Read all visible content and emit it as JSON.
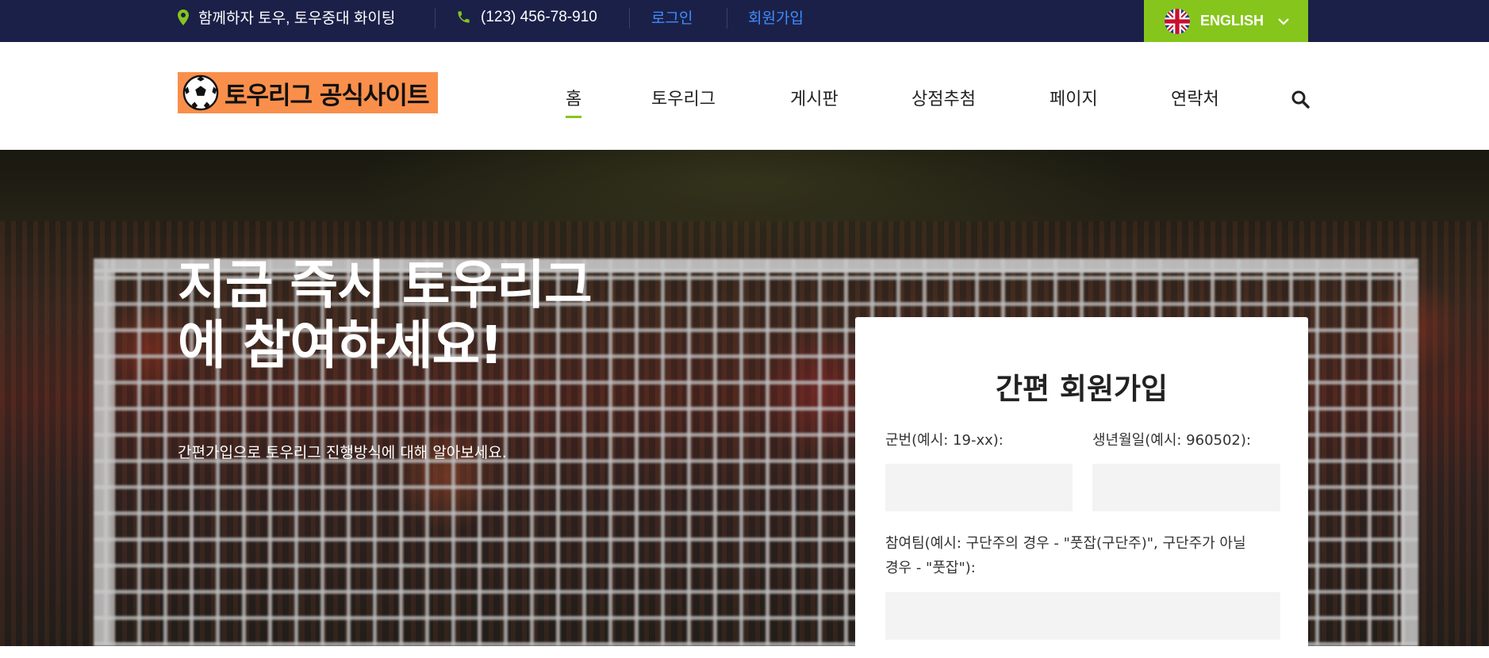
{
  "topbar": {
    "address": "함께하자 토우, 토우중대 화이팅",
    "phone": "(123) 456-78-910",
    "login": "로그인",
    "register": "회원가입",
    "language": "ENGLISH",
    "icons": {
      "pin": "map-pin-icon",
      "phone": "phone-icon",
      "flag": "uk-flag-icon",
      "chevron": "chevron-down-icon"
    },
    "colors": {
      "background": "#1b2048",
      "link": "#3f8dff",
      "accent": "#86c51c"
    }
  },
  "header": {
    "logo_text": "토우리그 공식사이트",
    "logo_bg": "#f98f4b",
    "nav": [
      {
        "label": "홈",
        "active": true
      },
      {
        "label": "토우리그",
        "active": false
      },
      {
        "label": "게시판",
        "active": false
      },
      {
        "label": "상점추첨",
        "active": false
      },
      {
        "label": "페이지",
        "active": false
      },
      {
        "label": "연락처",
        "active": false
      }
    ]
  },
  "hero": {
    "title_line1": "지금 즉시 토우리그",
    "title_line2": "에 참여하세요!",
    "subtitle": "간편가입으로 토우리그 진행방식에 대해 알아보세요."
  },
  "signup_form": {
    "title": "간편 회원가입",
    "field_id_label": "군번(예시: 19-xx):",
    "field_id_value": "",
    "field_birth_label": "생년월일(예시: 960502):",
    "field_birth_value": "",
    "field_team_label_line1": "참여팀(예시: 구단주의 경우 - \"풋잡(구단주)\", 구단주가 아닐",
    "field_team_label_line2": "경우 - \"풋잡\"):",
    "field_team_value": ""
  }
}
